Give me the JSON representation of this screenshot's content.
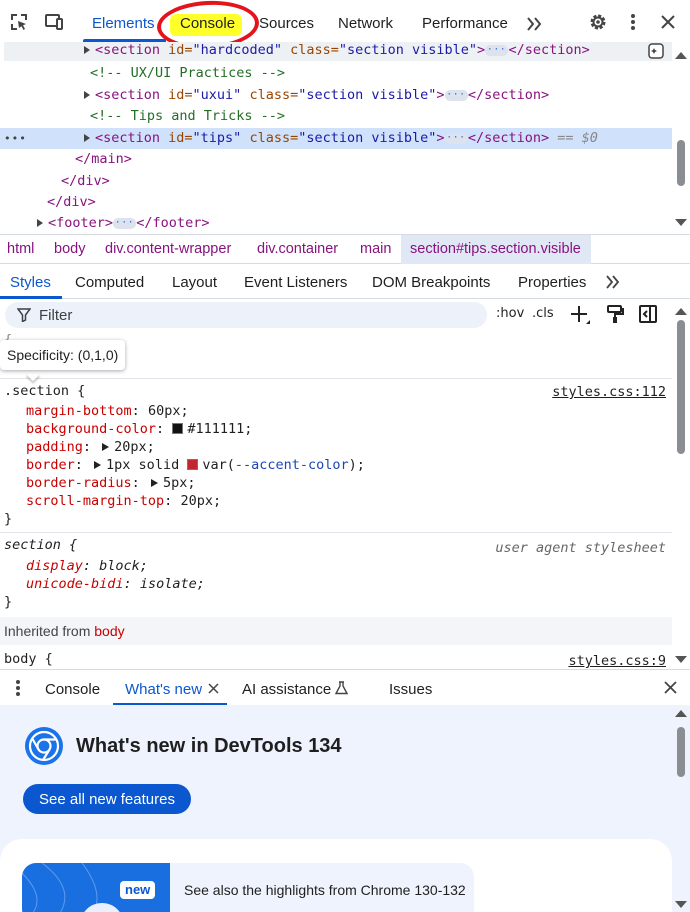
{
  "top_tabs": {
    "elements": "Elements",
    "console": "Console",
    "sources": "Sources",
    "network": "Network",
    "performance": "Performance"
  },
  "dom_tree": {
    "line1": {
      "tag_open": "<section",
      "id_attr": " id=",
      "id_val": "\"hardcoded\"",
      "class_attr": " class=",
      "class_val": "\"section visible\"",
      "gt": ">",
      "close": "</section>"
    },
    "comment1": "<!-- UX/UI Practices -->",
    "line2": {
      "tag_open": "<section",
      "id_attr": " id=",
      "id_val": "\"uxui\"",
      "class_attr": " class=",
      "class_val": "\"section visible\"",
      "gt": ">",
      "close": "</section>"
    },
    "comment2": "<!-- Tips and Tricks -->",
    "line3": {
      "tag_open": "<section",
      "id_attr": " id=",
      "id_val": "\"tips\"",
      "class_attr": " class=",
      "class_val": "\"section visible\"",
      "gt": ">",
      "close": "</section>",
      "eq": " == $0"
    },
    "close_main": "</main>",
    "close_div1": "</div>",
    "close_div2": "</div>",
    "footer_open": "<footer>",
    "footer_close": "</footer>"
  },
  "breadcrumb": [
    "html",
    "body",
    "div.content-wrapper",
    "div.container",
    "main",
    "section#tips.section.visible"
  ],
  "style_tabs": {
    "styles": "Styles",
    "computed": "Computed",
    "layout": "Layout",
    "event_listeners": "Event Listeners",
    "dom_breakpoints": "DOM Breakpoints",
    "properties": "Properties"
  },
  "filter": {
    "placeholder": "Filter",
    "hov": ":hov",
    "cls": ".cls"
  },
  "tooltip": "Specificity: (0,1,0)",
  "rules": {
    "section_rule": {
      "selector": ".section {",
      "source": "styles.css:112",
      "props": [
        {
          "name": "margin-bottom",
          "value": "60px;"
        },
        {
          "name": "background-color",
          "value": "#111111;",
          "swatch": "#111111"
        },
        {
          "name": "padding",
          "value": "20px;"
        },
        {
          "name": "border",
          "value": "1px solid ",
          "swatch": "#c1272d",
          "var_prefix": "var(",
          "var_name": "--accent-color",
          "var_suffix": ");"
        },
        {
          "name": "border-radius",
          "value": "5px;"
        },
        {
          "name": "scroll-margin-top",
          "value": "20px;"
        }
      ],
      "close": "}"
    },
    "ua_rule": {
      "selector": "section {",
      "source": "user agent stylesheet",
      "props": [
        {
          "name": "display",
          "value": "block;"
        },
        {
          "name": "unicode-bidi",
          "value": "isolate;"
        }
      ],
      "close": "}"
    },
    "inherited_label": "Inherited from",
    "inherited_from": "body",
    "body_rule": {
      "selector": "body {",
      "source": "styles.css:9"
    }
  },
  "drawer": {
    "tabs": {
      "console": "Console",
      "whats_new": "What's new",
      "ai_assistance": "AI assistance",
      "issues": "Issues"
    },
    "title": "What's new in DevTools 134",
    "button": "See all new features",
    "badge": "new",
    "card_text": "See also the highlights from Chrome 130-132"
  },
  "colors": {
    "accent_blue": "#0b57d0",
    "highlight_yellow": "#ffff2a",
    "annotation_red": "#e3141b",
    "selected_row": "#cfe1fb"
  }
}
